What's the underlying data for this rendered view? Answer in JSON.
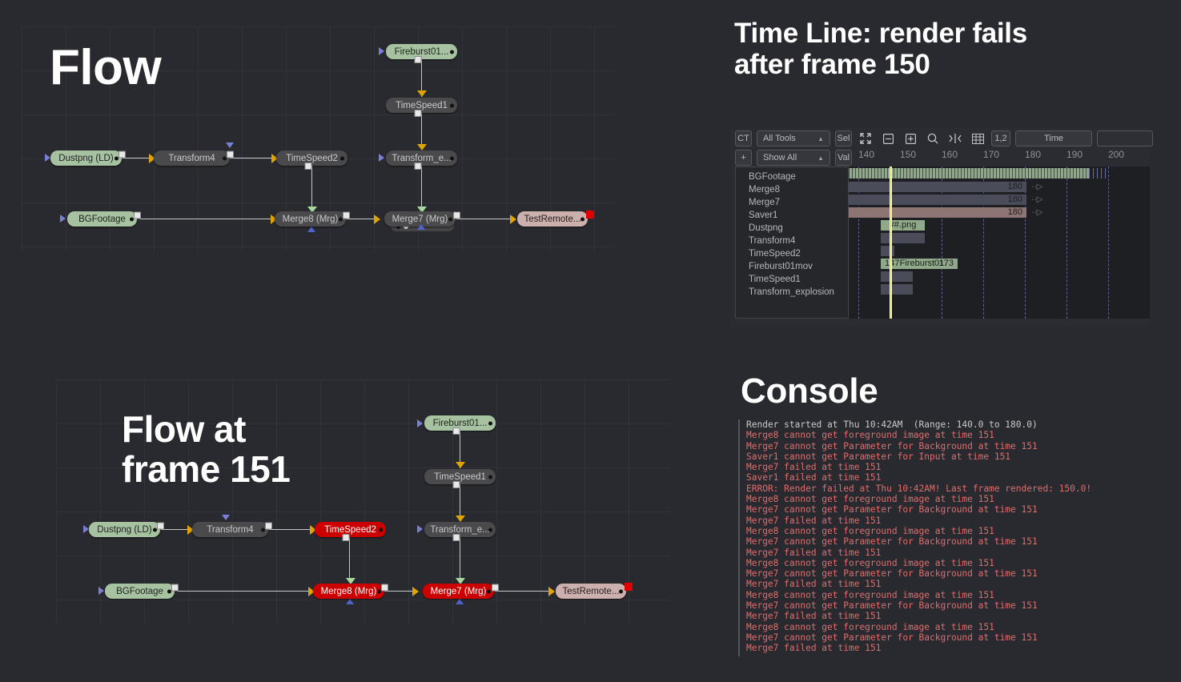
{
  "flow_top": {
    "title": "Flow",
    "nodes": [
      {
        "name": "Dustpng  (LD)",
        "type": "green"
      },
      {
        "name": "Transform4",
        "type": "gray"
      },
      {
        "name": "TimeSpeed2",
        "type": "gray"
      },
      {
        "name": "BGFootage",
        "type": "green"
      },
      {
        "name": "Fireburst01...",
        "type": "green"
      },
      {
        "name": "TimeSpeed1",
        "type": "gray"
      },
      {
        "name": "Transform_e...",
        "type": "gray"
      },
      {
        "name": "Merge8  (Mrg)",
        "type": "gray"
      },
      {
        "name": "Merge7  (Mrg)",
        "type": "gray"
      },
      {
        "name": "TestRemote...",
        "type": "pink"
      }
    ]
  },
  "flow_bottom": {
    "title": "Flow at\nframe 151",
    "nodes": [
      {
        "name": "Dustpng  (LD)",
        "type": "green"
      },
      {
        "name": "Transform4",
        "type": "gray"
      },
      {
        "name": "TimeSpeed2",
        "type": "red"
      },
      {
        "name": "BGFootage",
        "type": "green"
      },
      {
        "name": "Fireburst01...",
        "type": "green"
      },
      {
        "name": "TimeSpeed1",
        "type": "gray"
      },
      {
        "name": "Transform_e...",
        "type": "gray"
      },
      {
        "name": "Merge8  (Mrg)",
        "type": "red"
      },
      {
        "name": "Merge7  (Mrg)",
        "type": "red"
      },
      {
        "name": "TestRemote...",
        "type": "pink"
      }
    ]
  },
  "timeline": {
    "heading": "Time Line: render fails\nafter frame 150",
    "toolbar": {
      "ct_label": "CT",
      "all_tools_label": "All Tools",
      "sel_label": "Sel",
      "plus_label": "+",
      "show_all_label": "Show All",
      "val_label": "Val",
      "layers_label": "1,2",
      "time_label": "Time",
      "field_value": ""
    },
    "icons": [
      "expand-icon",
      "collapse-icon",
      "expand-box-icon",
      "zoom-icon",
      "fit-icon",
      "grid-icon"
    ],
    "ruler_ticks": [
      "140",
      "150",
      "160",
      "170",
      "180",
      "190",
      "200"
    ],
    "playhead_frame": "151",
    "tracks": [
      {
        "name": "BGFootage",
        "style": "green-hatch",
        "label": ""
      },
      {
        "name": "Merge8",
        "style": "gray",
        "label": "180"
      },
      {
        "name": "Merge7",
        "style": "gray",
        "label": "180"
      },
      {
        "name": "Saver1",
        "style": "rose",
        "label": "180"
      },
      {
        "name": "Dustpng",
        "style": "green",
        "label": "##.png"
      },
      {
        "name": "Transform4",
        "style": "gray",
        "label": ""
      },
      {
        "name": "TimeSpeed2",
        "style": "gray",
        "label": ""
      },
      {
        "name": "Fireburst01mov",
        "style": "green",
        "label_left": "147",
        "label_center": "Fireburst01.",
        "label_right": "173"
      },
      {
        "name": "TimeSpeed1",
        "style": "gray",
        "label": ""
      },
      {
        "name": "Transform_explosion",
        "style": "gray",
        "label": ""
      }
    ]
  },
  "console": {
    "heading": "Console",
    "lines": [
      {
        "text": "Render started at Thu 10:42AM  (Range: 140.0 to 180.0)",
        "kind": "info"
      },
      {
        "text": "Merge8 cannot get foreground image at time 151",
        "kind": "error"
      },
      {
        "text": "Merge7 cannot get Parameter for Background at time 151",
        "kind": "error"
      },
      {
        "text": "Saver1 cannot get Parameter for Input at time 151",
        "kind": "error"
      },
      {
        "text": "Merge7 failed at time 151",
        "kind": "error"
      },
      {
        "text": "Saver1 failed at time 151",
        "kind": "error"
      },
      {
        "text": "ERROR: Render failed at Thu 10:42AM! Last frame rendered: 150.0!",
        "kind": "error"
      },
      {
        "text": "Merge8 cannot get foreground image at time 151",
        "kind": "error"
      },
      {
        "text": "Merge7 cannot get Parameter for Background at time 151",
        "kind": "error"
      },
      {
        "text": "Merge7 failed at time 151",
        "kind": "error"
      },
      {
        "text": "Merge8 cannot get foreground image at time 151",
        "kind": "error"
      },
      {
        "text": "Merge7 cannot get Parameter for Background at time 151",
        "kind": "error"
      },
      {
        "text": "Merge7 failed at time 151",
        "kind": "error"
      },
      {
        "text": "Merge8 cannot get foreground image at time 151",
        "kind": "error"
      },
      {
        "text": "Merge7 cannot get Parameter for Background at time 151",
        "kind": "error"
      },
      {
        "text": "Merge7 failed at time 151",
        "kind": "error"
      },
      {
        "text": "Merge8 cannot get foreground image at time 151",
        "kind": "error"
      },
      {
        "text": "Merge7 cannot get Parameter for Background at time 151",
        "kind": "error"
      },
      {
        "text": "Merge7 failed at time 151",
        "kind": "error"
      },
      {
        "text": "Merge8 cannot get foreground image at time 151",
        "kind": "error"
      },
      {
        "text": "Merge7 cannot get Parameter for Background at time 151",
        "kind": "error"
      },
      {
        "text": "Merge7 failed at time 151",
        "kind": "error"
      }
    ]
  },
  "colors": {
    "background": "#292a2f",
    "node_gray": "#4a4a4d",
    "node_green": "#a6c2a0",
    "node_red": "#cc0000",
    "node_pink": "#ccb0ae",
    "error_text": "#e06c6c",
    "playhead": "#ffffff"
  }
}
